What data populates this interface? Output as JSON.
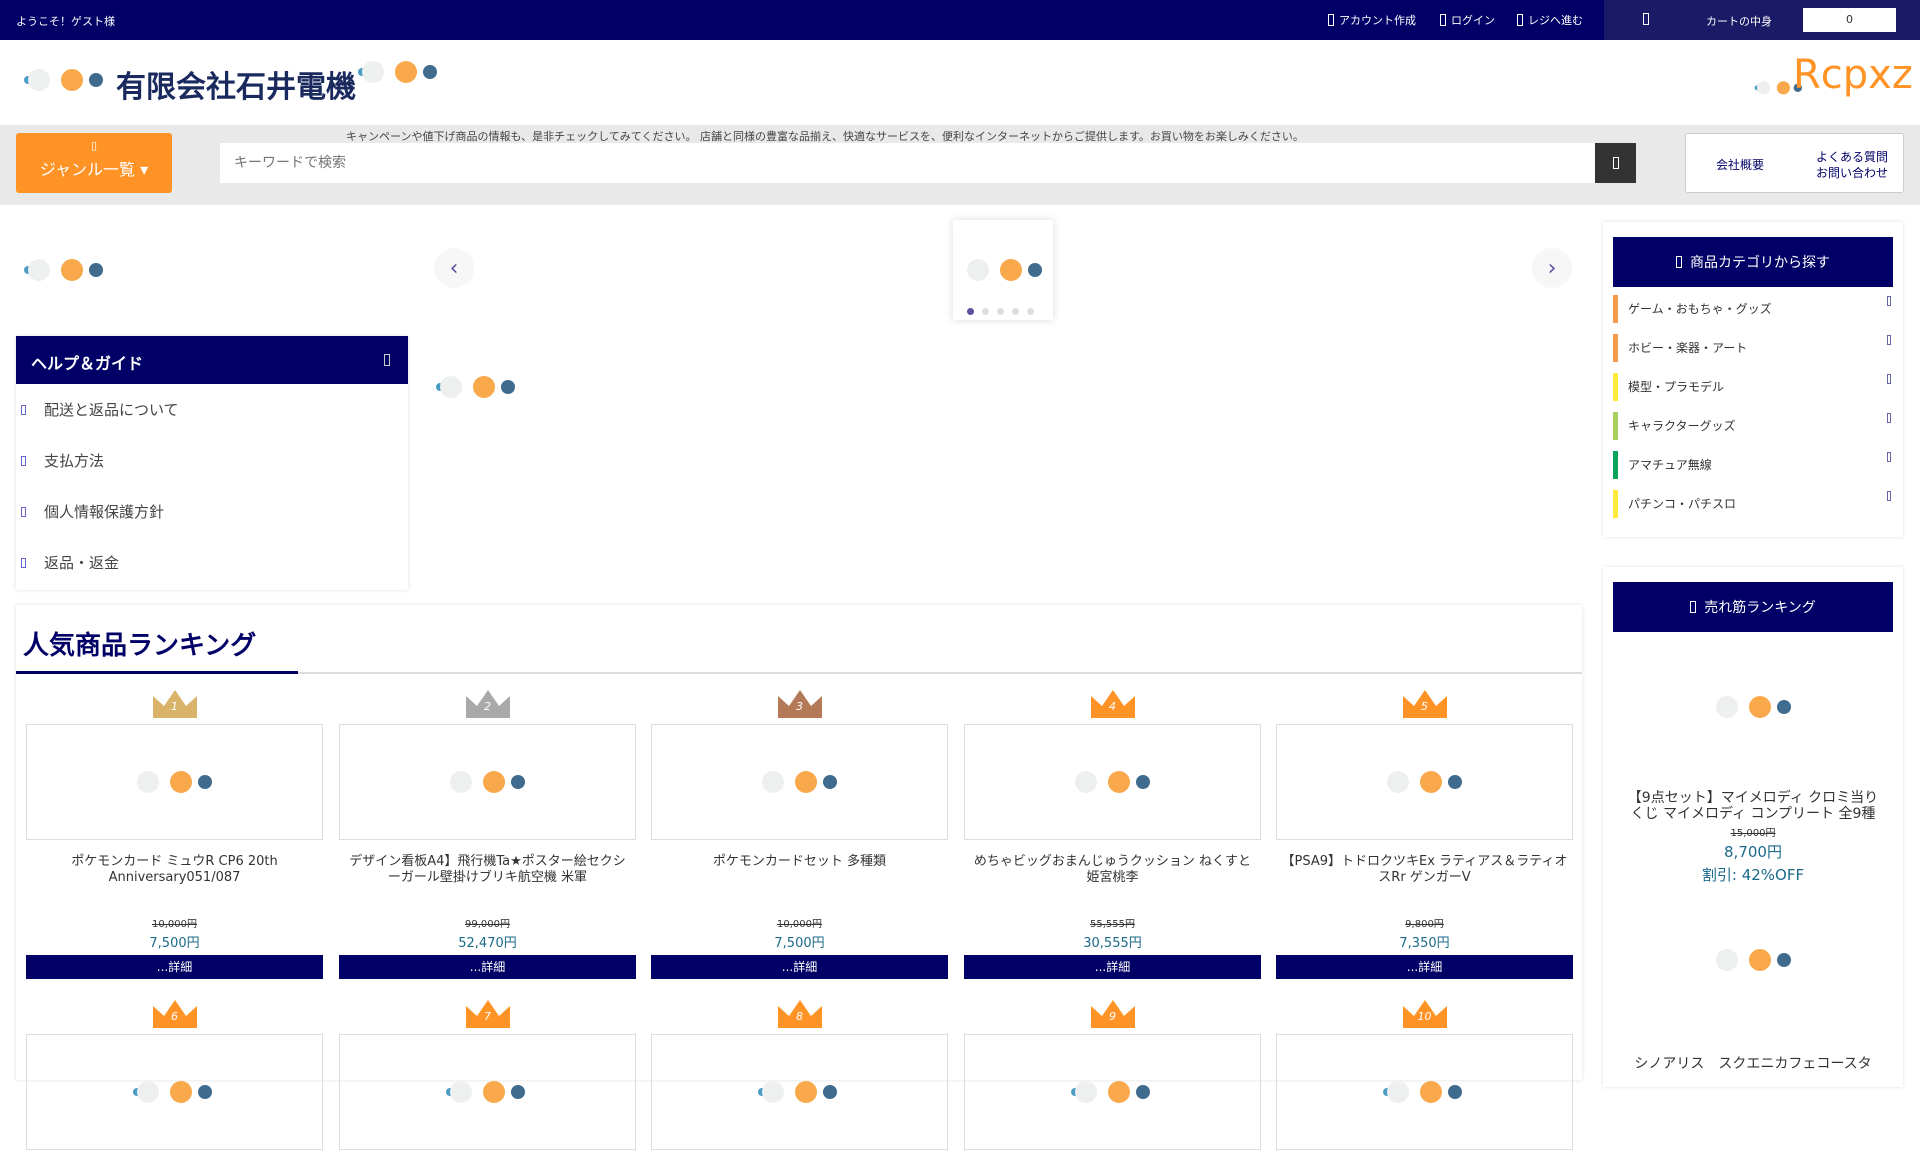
{
  "topbar": {
    "welcome": "ようこそ！ゲスト様",
    "links": [
      "アカウント作成",
      "ログイン",
      "レジへ進む"
    ],
    "cart_label": "カートの中身",
    "cart_count": "0"
  },
  "header": {
    "brand": "有限会社石井電機",
    "logo_text": "Rcpxz"
  },
  "nav": {
    "genre_label": "ジャンル一覧",
    "marquee": "キャンペーンや値下げ商品の情報も、是非チェックしてみてください。 店舗と同様の豊富な品揃え、快適なサービスを、便利なインターネットからご提供します。お買い物をお楽しみください。",
    "search_placeholder": "キーワードで検索",
    "company_link": "会社概要",
    "faq_link": "よくある質問",
    "contact_link": "お問い合わせ"
  },
  "carousel": {
    "slides": 5,
    "active": 1
  },
  "help": {
    "title": "ヘルプ＆ガイド",
    "items": [
      "配送と返品について",
      "支払方法",
      "個人情報保護方針",
      "返品・返金"
    ]
  },
  "categories": {
    "title": "商品カテゴリから探す",
    "items": [
      {
        "label": "ゲーム・おもちゃ・グッズ",
        "color": "#f59a46"
      },
      {
        "label": "ホビー・楽器・アート",
        "color": "#f59a46"
      },
      {
        "label": "模型・プラモデル",
        "color": "#ffeb3b"
      },
      {
        "label": "キャラクターグッズ",
        "color": "#a8d05a"
      },
      {
        "label": "アマチュア無線",
        "color": "#0aa55a"
      },
      {
        "label": "パチンコ・パチスロ",
        "color": "#ffeb3b"
      }
    ]
  },
  "bestsellers": {
    "title": "売れ筋ランキング",
    "items": [
      {
        "name": "【9点セット】マイメロディ クロミ当りくじ マイメロディ コンプリート 全9種",
        "old_price": "15,000円",
        "price": "8,700円",
        "discount": "割引: 42%OFF"
      },
      {
        "name": "シノアリス　スクエニカフェコースタ"
      }
    ]
  },
  "ranking": {
    "title": "人気商品ランキング",
    "detail_label": "...詳細",
    "products": [
      {
        "rank": "1",
        "name": "ポケモンカード ミュウR CP6 20th Anniversary051/087",
        "old_price": "10,000円",
        "price": "7,500円",
        "crown": "#d9b36a"
      },
      {
        "rank": "2",
        "name": "デザイン看板A4】飛行機Ta★ポスター絵セクシーガール壁掛けブリキ航空機 米軍",
        "old_price": "99,000円",
        "price": "52,470円",
        "crown": "#a9a9a9"
      },
      {
        "rank": "3",
        "name": "ポケモンカードセット 多種類",
        "old_price": "10,000円",
        "price": "7,500円",
        "crown": "#b47a58"
      },
      {
        "rank": "4",
        "name": "めちゃビッグおまんじゅうクッション ねくすと 姫宮桃李",
        "old_price": "55,555円",
        "price": "30,555円",
        "crown": "#ff9326"
      },
      {
        "rank": "5",
        "name": "【PSA9】トドロクツキEx ラティアス＆ラティオスRr ゲンガーV",
        "old_price": "9,800円",
        "price": "7,350円",
        "crown": "#ff9326"
      },
      {
        "rank": "6",
        "crown": "#ff9326"
      },
      {
        "rank": "7",
        "crown": "#ff9326"
      },
      {
        "rank": "8",
        "crown": "#ff9326"
      },
      {
        "rank": "9",
        "crown": "#ff9326"
      },
      {
        "rank": "10",
        "crown": "#ff9326"
      }
    ]
  }
}
